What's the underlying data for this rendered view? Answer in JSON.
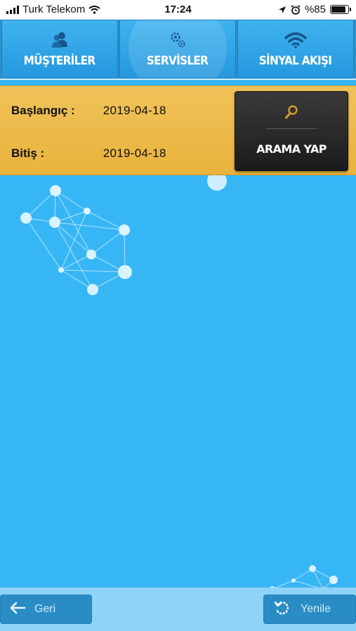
{
  "status_bar": {
    "carrier": "Turk Telekom",
    "time": "17:24",
    "battery": "%85",
    "battery_level": 0.85
  },
  "nav": {
    "tabs": [
      {
        "label": "MÜŞTERİLER",
        "icon": "users-icon"
      },
      {
        "label": "SERVİSLER",
        "icon": "gears-icon",
        "active": true
      },
      {
        "label": "SİNYAL AKIŞI",
        "icon": "wifi-icon"
      }
    ]
  },
  "filter": {
    "start_label": "Başlangıç :",
    "start_value": "2019-04-18",
    "end_label": "Bitiş :",
    "end_value": "2019-04-18",
    "search_button": "ARAMA YAP",
    "search_icon": "search-icon"
  },
  "bottom_bar": {
    "back_label": "Geri",
    "refresh_label": "Yenile"
  },
  "colors": {
    "background": "#37b6f6",
    "nav": "#2f8fc8",
    "panel": "#ecb84a",
    "button_dark": "#262626"
  }
}
